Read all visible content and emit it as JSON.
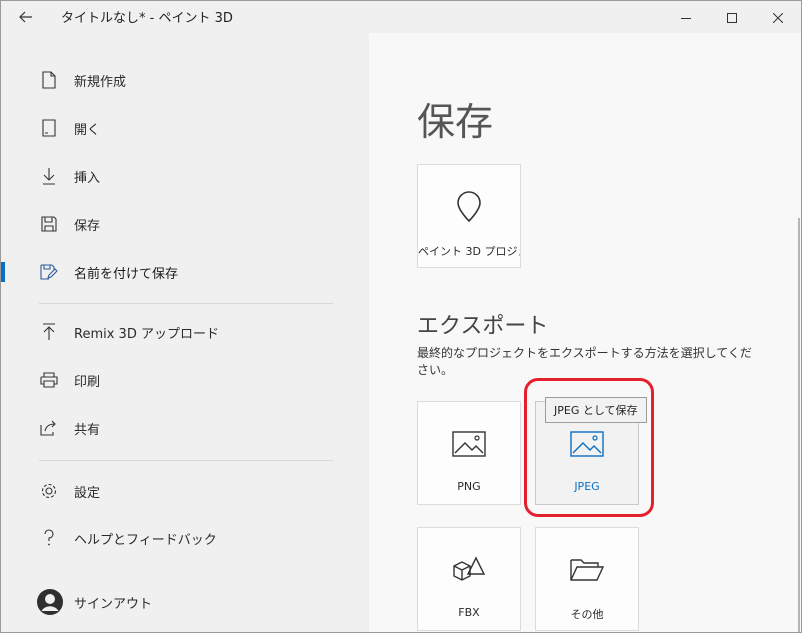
{
  "window": {
    "title": "タイトルなし* - ペイント 3D",
    "back_icon": "arrow-left-icon",
    "controls": [
      "minimize-icon",
      "maximize-icon",
      "close-icon"
    ]
  },
  "sidebar": {
    "items": [
      {
        "label": "新規作成",
        "icon": "new-document-icon"
      },
      {
        "label": "開く",
        "icon": "open-icon"
      },
      {
        "label": "挿入",
        "icon": "insert-icon"
      },
      {
        "label": "保存",
        "icon": "save-icon"
      },
      {
        "label": "名前を付けて保存",
        "icon": "save-as-icon",
        "active": true
      },
      {
        "label": "Remix 3D アップロード",
        "icon": "upload-icon"
      },
      {
        "label": "印刷",
        "icon": "print-icon"
      },
      {
        "label": "共有",
        "icon": "share-icon"
      },
      {
        "label": "設定",
        "icon": "gear-icon"
      },
      {
        "label": "ヘルプとフィードバック",
        "icon": "help-icon"
      },
      {
        "label": "サインアウト",
        "icon": "avatar-icon"
      }
    ]
  },
  "main": {
    "heading": "保存",
    "project_tile": {
      "label": "ペイント 3D プロジェ..."
    },
    "export": {
      "title": "エクスポート",
      "description": "最終的なプロジェクトをエクスポートする方法を選択してください。",
      "tiles": [
        {
          "label": "PNG",
          "icon": "image-icon"
        },
        {
          "label": "JPEG",
          "icon": "image-icon"
        },
        {
          "label": "FBX",
          "icon": "3d-shapes-icon"
        },
        {
          "label": "その他",
          "icon": "folder-icon"
        }
      ],
      "tooltip": "JPEG として保存"
    }
  },
  "colors": {
    "accent": "#0a6fc2",
    "highlight": "#e4202e"
  }
}
